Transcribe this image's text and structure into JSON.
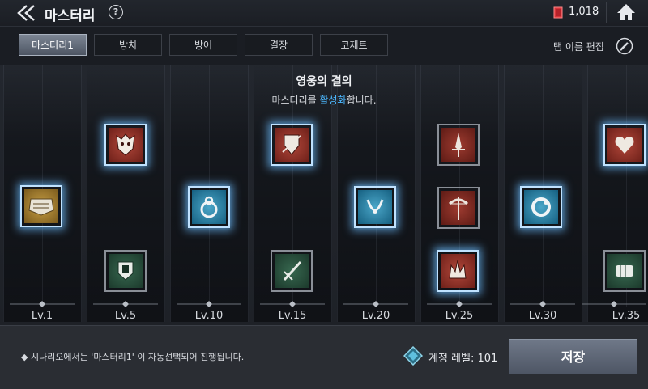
{
  "header": {
    "title": "마스터리",
    "help": "?",
    "currency": "1,018"
  },
  "tabs": [
    "마스터리1",
    "방치",
    "방어",
    "결장",
    "코제트"
  ],
  "rename_label": "탭 이름 편집",
  "panel": {
    "heading": "영웅의 결의",
    "sub_pre": "마스터리를 ",
    "sub_highlight": "활성화",
    "sub_post": "합니다."
  },
  "levels": [
    "Lv.1",
    "Lv.5",
    "Lv.10",
    "Lv.15",
    "Lv.20",
    "Lv.25",
    "Lv.30",
    "Lv.35"
  ],
  "footer": {
    "note": "◆ 시나리오에서는 '마스터리1' 이 자동선택되어 진행됩니다.",
    "account_level": "계정 레벨: 101",
    "save": "저장"
  },
  "colors": {
    "accent_blue": "#4cb8ff",
    "gem_red": "#d8343a",
    "slot_red": "#8e2e25",
    "slot_blue": "#1f7da3",
    "slot_green": "#244b3a",
    "slot_gold": "#9a7a2e"
  }
}
